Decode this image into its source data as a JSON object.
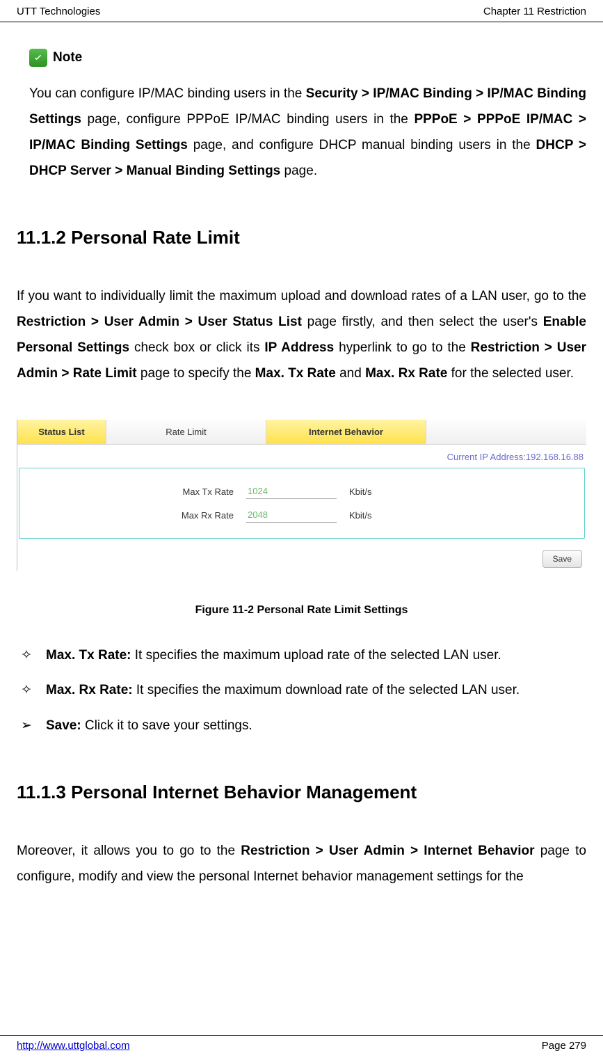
{
  "header": {
    "left": "UTT Technologies",
    "right": "Chapter 11 Restriction"
  },
  "note": {
    "label": "Note",
    "seg1": "You can configure IP/MAC binding users in the ",
    "b1": "Security > IP/MAC Binding > IP/MAC Binding Settings",
    "seg2": " page, configure PPPoE IP/MAC binding users in the ",
    "b2": "PPPoE > PPPoE IP/MAC > IP/MAC Binding Settings",
    "seg3": " page, and configure DHCP manual binding users in the ",
    "b3": "DHCP > DHCP Server > Manual Binding Settings",
    "seg4": " page."
  },
  "s112": {
    "title": "11.1.2  Personal Rate Limit",
    "p_seg1": "If you want to individually limit the maximum upload and download rates of a LAN user, go to the ",
    "p_b1": "Restriction > User Admin > User Status List",
    "p_seg2": " page firstly, and then select the user's ",
    "p_b2": "Enable Personal Settings",
    "p_seg3": " check box or click its ",
    "p_b3": "IP Address",
    "p_seg4": " hyperlink to go to the ",
    "p_b4": "Restriction > User Admin > Rate Limit",
    "p_seg5": " page to specify the ",
    "p_b5": "Max. Tx Rate",
    "p_seg6": " and ",
    "p_b6": "Max. Rx Rate",
    "p_seg7": " for the selected user."
  },
  "figure": {
    "tabs": {
      "status": "Status List",
      "rate": "Rate Limit",
      "behavior": "Internet Behavior"
    },
    "ip_label": "Current IP Address:192.168.16.88",
    "form": {
      "tx_label": "Max Tx Rate",
      "tx_value": "1024",
      "rx_label": "Max Rx Rate",
      "rx_value": "2048",
      "unit": "Kbit/s"
    },
    "save": "Save",
    "caption": "Figure 11-2 Personal Rate Limit Settings"
  },
  "bullets": {
    "diamond": "✧",
    "arrow": "➢",
    "txrate_b": "Max. Tx Rate:",
    "txrate_t": " It specifies the maximum upload rate of the selected LAN user.",
    "rxrate_b": "Max. Rx Rate:",
    "rxrate_t": " It specifies the maximum download rate of the selected LAN user.",
    "save_b": "Save:",
    "save_t": " Click it to save your settings."
  },
  "s113": {
    "title": "11.1.3  Personal Internet Behavior Management",
    "p_seg1": "Moreover, it allows you to go to the ",
    "p_b1": "Restriction > User Admin > Internet Behavior",
    "p_seg2": " page to configure, modify and view the personal Internet behavior management settings for the"
  },
  "footer": {
    "url": "http://www.uttglobal.com",
    "page": "Page 279"
  }
}
